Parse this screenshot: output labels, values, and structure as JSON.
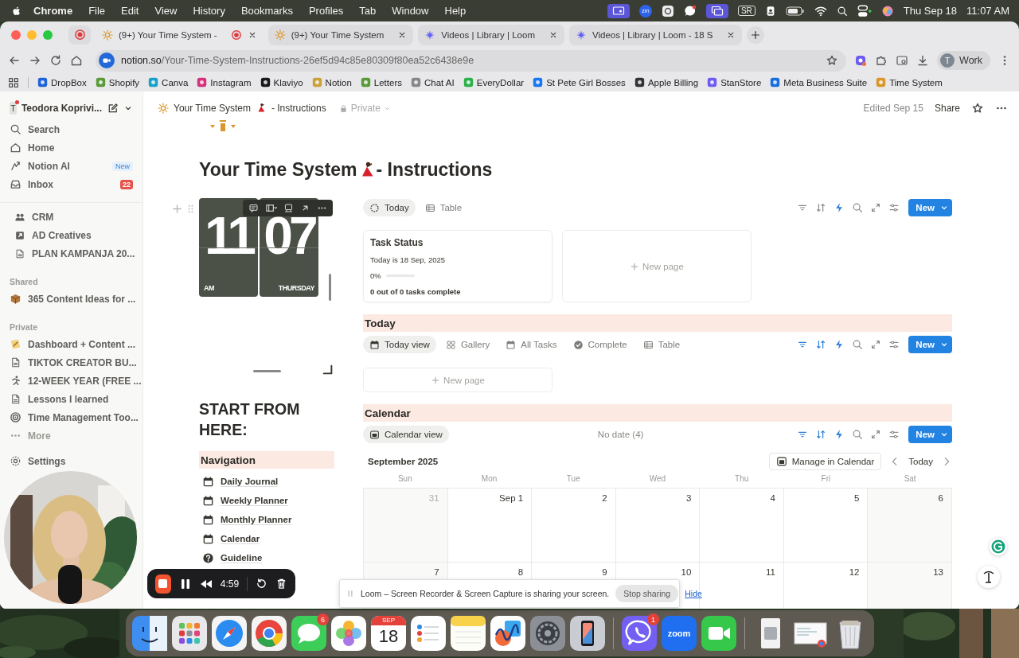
{
  "menubar": {
    "app": "Chrome",
    "menus": [
      "File",
      "Edit",
      "View",
      "History",
      "Bookmarks",
      "Profiles",
      "Tab",
      "Window",
      "Help"
    ],
    "zoom_status": "zm",
    "status_text": "SR",
    "date": "Thu Sep 18",
    "time": "11:07 AM"
  },
  "tabs": [
    {
      "title": "(9+) Your Time System -",
      "selected": true,
      "recording": true
    },
    {
      "title": "(9+) Your Time System",
      "selected": false,
      "recording": false
    },
    {
      "title": "Videos | Library | Loom",
      "selected": false,
      "recording": false
    },
    {
      "title": "Videos | Library | Loom - 18 S",
      "selected": false,
      "recording": false
    }
  ],
  "address": {
    "host": "notion.so",
    "path": "/Your-Time-System-Instructions-26ef5d94c85e80309f80ea52c6438e9e"
  },
  "profile": {
    "initial": "T",
    "name": "Work"
  },
  "bookmarks": [
    "DropBox",
    "Shopify",
    "Canva",
    "Instagram",
    "Klaviyo",
    "Notion",
    "Letters",
    "Chat AI",
    "EveryDollar",
    "St Pete Girl Bosses",
    "Apple Billing",
    "StanStore",
    "Meta Business Suite",
    "Time System"
  ],
  "sidebar": {
    "workspace": {
      "initial": "T",
      "name": "Teodora Koprivi..."
    },
    "nav": [
      {
        "label": "Search"
      },
      {
        "label": "Home"
      },
      {
        "label": "Notion AI",
        "badge": "New"
      },
      {
        "label": "Inbox",
        "count": "22"
      }
    ],
    "pages": [
      "CRM",
      "AD Creatives",
      "PLAN KAMPANJA 20..."
    ],
    "sections": [
      {
        "title": "Shared",
        "items": [
          "365 Content Ideas for ..."
        ]
      },
      {
        "title": "Private",
        "items": [
          "Dashboard + Content ...",
          "TIKTOK CREATOR BU...",
          "12-WEEK YEAR (FREE ...",
          "Lessons I learned",
          "Time Management Too..."
        ],
        "more": "More"
      }
    ],
    "settings": "Settings"
  },
  "topbar": {
    "title_start": "Your Time System",
    "title_end": "- Instructions",
    "privacy": "Private",
    "edited": "Edited Sep 15",
    "share": "Share"
  },
  "page": {
    "title_start": "Your Time System",
    "title_end": "- Instructions"
  },
  "clock": {
    "hours": "11",
    "minutes": "07",
    "period": "AM",
    "day": "THURSDAY"
  },
  "start_heading": "START FROM HERE:",
  "navigation": {
    "heading": "Navigation",
    "links": [
      {
        "label": "Daily Journal",
        "kind": "calendar"
      },
      {
        "label": "Weekly Planner",
        "kind": "calendar"
      },
      {
        "label": "Monthly Planner",
        "kind": "calendar"
      },
      {
        "label": "Calendar",
        "kind": "calendar"
      },
      {
        "label": "Guideline",
        "kind": "help"
      }
    ]
  },
  "status_board": {
    "views": [
      {
        "label": "Today",
        "selected": true
      },
      {
        "label": "Table",
        "selected": false
      }
    ],
    "filter_active": false,
    "new_button": "New",
    "card": {
      "title": "Task Status",
      "date": "Today is 18 Sep, 2025",
      "percent": "0%",
      "level": 0,
      "summary": "0 out of 0 tasks complete"
    },
    "new_page": "New page"
  },
  "today_section": {
    "heading": "Today",
    "views": [
      {
        "label": "Today view",
        "selected": true
      },
      {
        "label": "Gallery",
        "selected": false
      },
      {
        "label": "All Tasks",
        "selected": false
      },
      {
        "label": "Complete",
        "selected": false
      },
      {
        "label": "Table",
        "selected": false
      }
    ],
    "filter_active": true,
    "new_button": "New",
    "new_page": "New page"
  },
  "calendar_section": {
    "heading": "Calendar",
    "views": [
      {
        "label": "Calendar view",
        "selected": true
      }
    ],
    "no_date": "No date (4)",
    "filter_active": true,
    "new_button": "New",
    "month": "September 2025",
    "manage": "Manage in Calendar",
    "today": "Today",
    "weekdays": [
      "Sun",
      "Mon",
      "Tue",
      "Wed",
      "Thu",
      "Fri",
      "Sat"
    ],
    "weeks": [
      [
        {
          "day": "31",
          "outside": true
        },
        {
          "day": "Sep 1",
          "outside": false
        },
        {
          "day": "2",
          "outside": false
        },
        {
          "day": "3",
          "outside": false
        },
        {
          "day": "4",
          "outside": false
        },
        {
          "day": "5",
          "outside": false
        },
        {
          "day": "6",
          "outside": false
        }
      ],
      [
        {
          "day": "7",
          "outside": false
        },
        {
          "day": "8",
          "outside": false
        },
        {
          "day": "9",
          "outside": false
        },
        {
          "day": "10",
          "outside": false
        },
        {
          "day": "11",
          "outside": false
        },
        {
          "day": "12",
          "outside": false
        },
        {
          "day": "13",
          "outside": false
        }
      ]
    ]
  },
  "recorder": {
    "time": "4:59"
  },
  "share_notice": {
    "message": "Loom – Screen Recorder & Screen Capture is sharing your screen.",
    "stop": "Stop sharing",
    "hide": "Hide"
  },
  "dock": {
    "messages_badge": "6",
    "calendar_month": "SEP",
    "calendar_day": "18",
    "call_badge": "1",
    "video_label": "zoom"
  }
}
